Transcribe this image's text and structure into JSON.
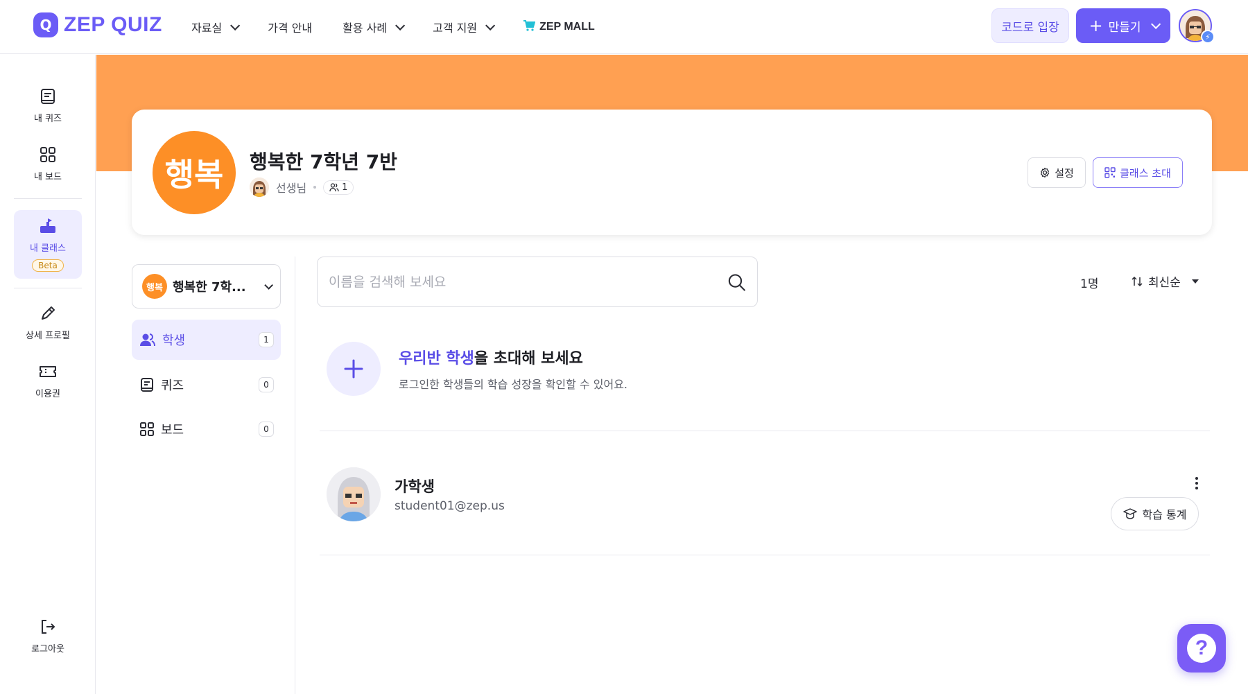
{
  "header": {
    "logo_text": "ZEP QUIZ",
    "nav": [
      {
        "label": "자료실",
        "has_dropdown": true
      },
      {
        "label": "가격 안내",
        "has_dropdown": false
      },
      {
        "label": "활용 사례",
        "has_dropdown": true
      },
      {
        "label": "고객 지원",
        "has_dropdown": true
      }
    ],
    "mall_label": "ZEP MALL",
    "code_entry_label": "코드로 입장",
    "create_label": "만들기"
  },
  "sidebar": {
    "items": [
      {
        "label": "내 퀴즈",
        "icon": "book-icon"
      },
      {
        "label": "내 보드",
        "icon": "grid-icon"
      },
      {
        "label": "내 클래스",
        "icon": "class-icon",
        "badge": "Beta",
        "active": true
      },
      {
        "label": "상세 프로필",
        "icon": "pencil-icon"
      },
      {
        "label": "이용권",
        "icon": "ticket-icon"
      }
    ],
    "logout_label": "로그아웃"
  },
  "class_card": {
    "avatar_text": "행복",
    "title": "행복한 7학년 7반",
    "teacher_label": "선생님",
    "member_count": "1",
    "settings_label": "설정",
    "invite_label": "클래스 초대"
  },
  "left_panel": {
    "class_select_avatar": "행복",
    "class_select_label": "행복한 7학...",
    "menu": [
      {
        "label": "학생",
        "count": "1",
        "active": true
      },
      {
        "label": "퀴즈",
        "count": "0",
        "active": false
      },
      {
        "label": "보드",
        "count": "0",
        "active": false
      }
    ]
  },
  "main": {
    "search_placeholder": "이름을 검색해 보세요",
    "count_label": "1명",
    "sort_label": "최신순",
    "invite_title_hl": "우리반 학생",
    "invite_title_rest": "을 초대해 보세요",
    "invite_sub": "로그인한 학생들의 학습 성장을 확인할 수 있어요.",
    "students": [
      {
        "name": "가학생",
        "email": "student01@zep.us",
        "stats_label": "학습 통계"
      }
    ]
  },
  "colors": {
    "accent": "#6b5cf6",
    "banner": "#ffa052",
    "class_avatar": "#fd8f26"
  }
}
